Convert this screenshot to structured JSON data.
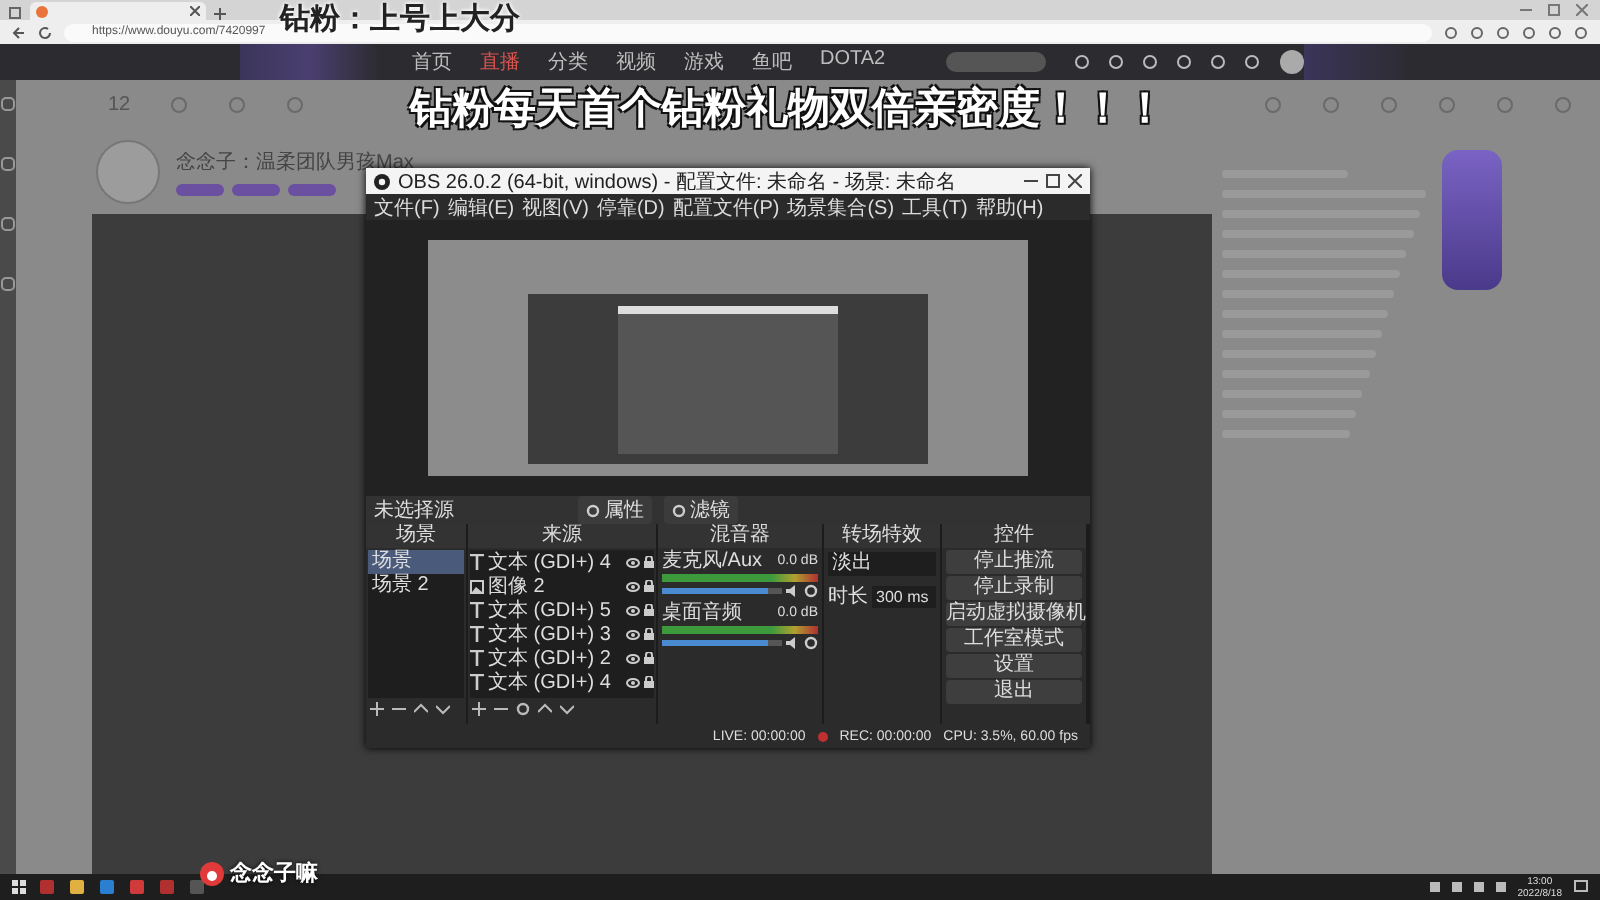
{
  "browser": {
    "url": "https://www.douyu.com/7420997"
  },
  "captions": [
    {
      "text": "钻粉：上号上大分",
      "kind": "small"
    },
    {
      "text": "钻粉每天首个钻粉礼物双倍亲密度！！！",
      "kind": "large"
    }
  ],
  "site_nav": [
    {
      "label": "首页",
      "selected": false
    },
    {
      "label": "直播",
      "selected": true
    },
    {
      "label": "分类",
      "selected": false
    },
    {
      "label": "视频",
      "selected": false
    },
    {
      "label": "游戏",
      "selected": false
    },
    {
      "label": "鱼吧",
      "selected": false
    },
    {
      "label": "DOTA2",
      "selected": false
    }
  ],
  "room": {
    "count": "12",
    "title": "念念子：温柔团队男孩Max"
  },
  "obs": {
    "title": "OBS 26.0.2 (64-bit, windows) - 配置文件: 未命名 - 场景: 未命名",
    "menu": [
      "文件(F)",
      "编辑(E)",
      "视图(V)",
      "停靠(D)",
      "配置文件(P)",
      "场景集合(S)",
      "工具(T)",
      "帮助(H)"
    ],
    "no_source": "未选择源",
    "source_buttons": [
      "属性",
      "滤镜"
    ],
    "scenes": {
      "title": "场景",
      "items": [
        {
          "label": "场景",
          "selected": true
        },
        {
          "label": "场景 2",
          "selected": false
        }
      ]
    },
    "sources": {
      "title": "来源",
      "items": [
        {
          "label": "文本 (GDI+) 4",
          "kind": "text"
        },
        {
          "label": "图像 2",
          "kind": "image"
        },
        {
          "label": "文本 (GDI+) 5",
          "kind": "text"
        },
        {
          "label": "文本 (GDI+) 3",
          "kind": "text"
        },
        {
          "label": "文本 (GDI+) 2",
          "kind": "text"
        },
        {
          "label": "文本 (GDI+) 4",
          "kind": "text"
        }
      ]
    },
    "mixer": {
      "title": "混音器",
      "channels": [
        {
          "name": "麦克风/Aux",
          "reading": "0.0 dB",
          "level": 0.88
        },
        {
          "name": "桌面音频",
          "reading": "0.0 dB",
          "level": 0.88
        }
      ]
    },
    "transitions": {
      "title": "转场特效",
      "type": "淡出",
      "duration_label": "时长",
      "duration": "300 ms"
    },
    "controls": {
      "title": "控件",
      "buttons": [
        "停止推流",
        "停止录制",
        "启动虚拟摄像机",
        "工作室模式",
        "设置",
        "退出"
      ]
    },
    "status": {
      "live": "LIVE: 00:00:00",
      "rec": "REC: 00:00:00",
      "cpu": "CPU: 3.5%, 60.00 fps"
    }
  },
  "taskbar": {
    "overlay_label": "念念子嘛",
    "time": "13:00",
    "date": "2022/8/18"
  }
}
